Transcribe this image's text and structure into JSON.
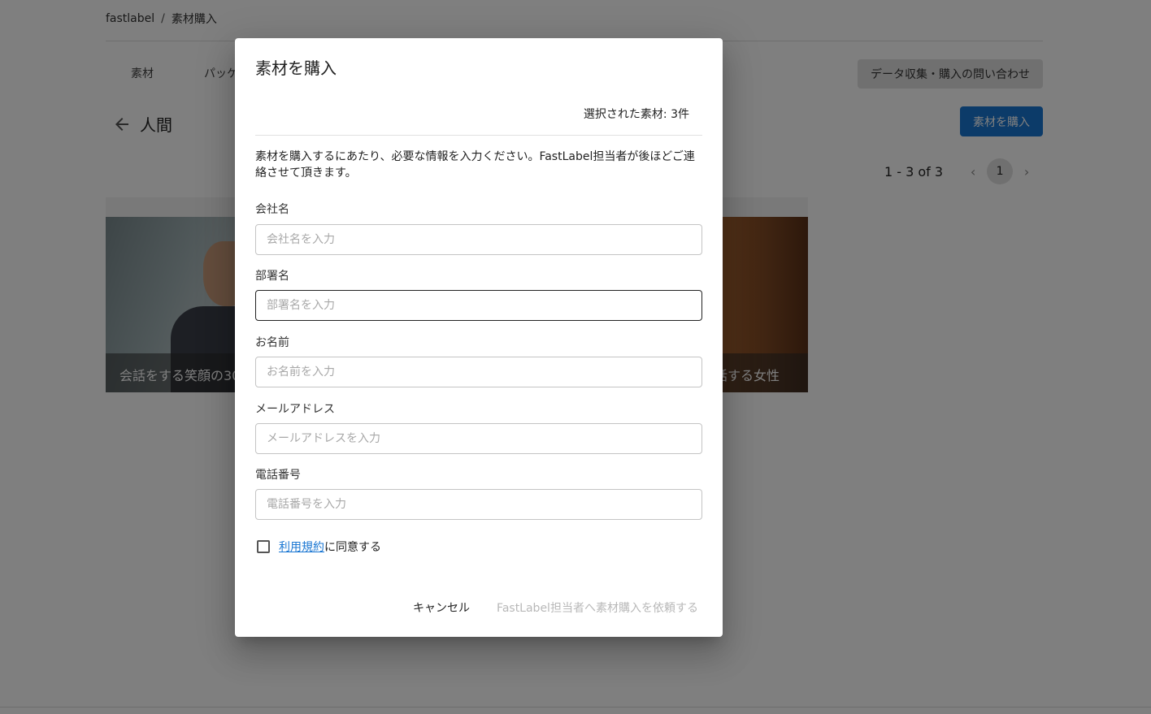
{
  "breadcrumb": {
    "root": "fastlabel",
    "separator": "/",
    "current": "素材購入"
  },
  "tabs": [
    {
      "label": "素材"
    },
    {
      "label": "パッケー"
    }
  ],
  "inquiry_button": "データ収集・購入の問い合わせ",
  "section": {
    "title": "人間"
  },
  "buy_button": "素材を購入",
  "pager": {
    "range": "1 - 3 of 3",
    "current_page": "1",
    "prev": "‹",
    "next": "›"
  },
  "cards": [
    {
      "caption": "会話をする笑顔の30"
    },
    {
      "caption": "話する女性"
    }
  ],
  "dialog": {
    "title": "素材を購入",
    "selected_count": "選択された素材: 3件",
    "description": "素材を購入するにあたり、必要な情報を入力ください。FastLabel担当者が後ほどご連絡させて頂きます。",
    "fields": [
      {
        "label": "会社名",
        "placeholder": "会社名を入力",
        "value": ""
      },
      {
        "label": "部署名",
        "placeholder": "部署名を入力",
        "value": ""
      },
      {
        "label": "お名前",
        "placeholder": "お名前を入力",
        "value": ""
      },
      {
        "label": "メールアドレス",
        "placeholder": "メールアドレスを入力",
        "value": ""
      },
      {
        "label": "電話番号",
        "placeholder": "電話番号を入力",
        "value": ""
      }
    ],
    "terms": {
      "link": "利用規約",
      "suffix": "に同意する",
      "checked": false
    },
    "cancel_button": "キャンセル",
    "request_button": "FastLabel担当者へ素材購入を依頼する"
  },
  "colors": {
    "primary": "#1976d2",
    "disabled_text": "#b8b8b8",
    "overlay": "rgba(0,0,0,0.5)"
  }
}
